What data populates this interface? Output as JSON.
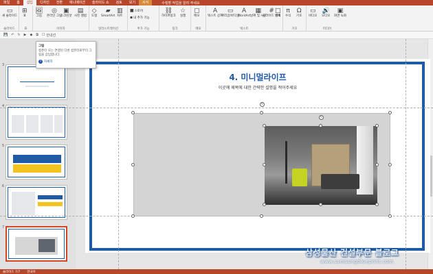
{
  "tabs": [
    "파일",
    "홈",
    "삽입",
    "디자인",
    "전환",
    "애니메이션",
    "슬라이드 쇼",
    "검토",
    "보기",
    "서식"
  ],
  "context_tab": "그리기 도구",
  "active_tab": "삽입",
  "tell_me": "수행할 작업을 알려 주세요",
  "ribbon": {
    "groups": [
      {
        "label": "슬라이드",
        "items": [
          "새 슬라이드"
        ]
      },
      {
        "label": "표",
        "items": [
          "표"
        ]
      },
      {
        "label": "이미지",
        "items": [
          "그림",
          "온라인 그림",
          "스크린샷",
          "사진 앨범"
        ]
      },
      {
        "label": "일러스트레이션",
        "items": [
          "도형",
          "SmartArt",
          "차트"
        ]
      },
      {
        "label": "추가 기능",
        "items": [
          "스토어",
          "내 추가 기능"
        ]
      },
      {
        "label": "링크",
        "items": [
          "하이퍼링크",
          "실행"
        ]
      },
      {
        "label": "메모",
        "items": [
          "메모"
        ]
      },
      {
        "label": "텍스트",
        "items": [
          "텍스트 상자",
          "머리글/바닥글",
          "WordArt",
          "날짜 및 시간",
          "슬라이드 번호",
          "개체"
        ]
      },
      {
        "label": "기호",
        "items": [
          "수식",
          "기호"
        ]
      },
      {
        "label": "미디어",
        "items": [
          "비디오",
          "오디오",
          "화면 녹화"
        ]
      }
    ]
  },
  "qat": {
    "items": [
      "저장",
      "실행 취소",
      "다시 실행",
      "처음부터"
    ],
    "guide_label": "안내선"
  },
  "tooltip": {
    "title": "그림",
    "body": "컴퓨터 또는 연결된 다른 컴퓨터로부터 그림을 삽입합니다.",
    "link": "자세히"
  },
  "slides": [
    {
      "num": "3"
    },
    {
      "num": "4"
    },
    {
      "num": "5"
    },
    {
      "num": "6"
    },
    {
      "num": "7"
    }
  ],
  "slide": {
    "title": "4. 미니멀라이프",
    "subtitle": "이곳에 제목에 대한 간략한 설명을 적어주세요"
  },
  "watermark": {
    "text": "삼성물산 건설부문 블로그",
    "url": "www.samsungblueprint.com"
  },
  "status": {
    "slide_info": "슬라이드 7/7",
    "language": "한국어"
  },
  "colors": {
    "accent": "#b7472a",
    "slide_blue": "#1f5aa6",
    "selection": "#d24726"
  }
}
